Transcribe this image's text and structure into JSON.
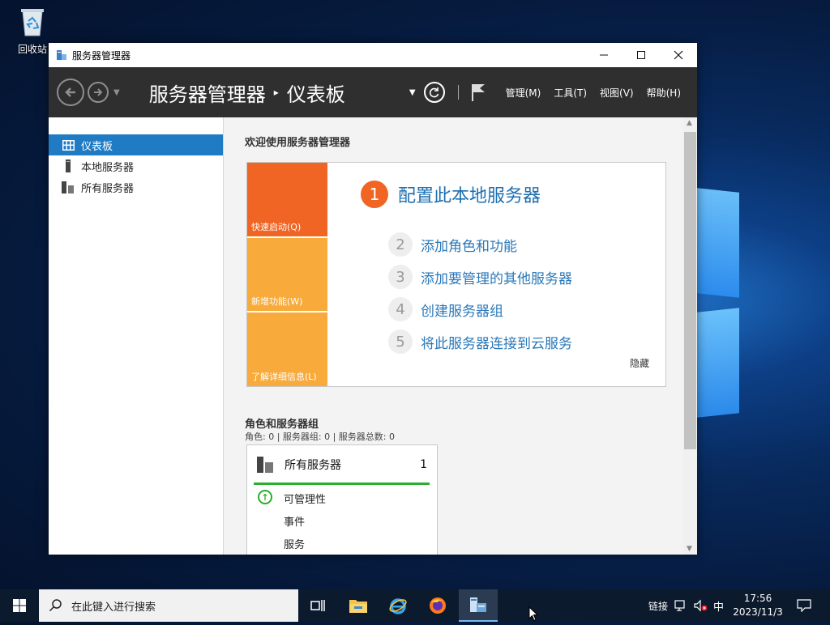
{
  "desktop": {
    "recycle_bin_label": "回收站"
  },
  "window": {
    "title": "服务器管理器",
    "controls": {
      "minimize": "—",
      "maximize": "☐",
      "close": "✕"
    }
  },
  "header": {
    "breadcrumb_root": "服务器管理器",
    "breadcrumb_sep": "▸",
    "breadcrumb_current": "仪表板",
    "menus": [
      "管理(M)",
      "工具(T)",
      "视图(V)",
      "帮助(H)"
    ]
  },
  "sidebar": {
    "items": [
      {
        "label": "仪表板",
        "icon": "dashboard-icon",
        "active": true
      },
      {
        "label": "本地服务器",
        "icon": "local-server-icon",
        "active": false
      },
      {
        "label": "所有服务器",
        "icon": "all-servers-icon",
        "active": false
      }
    ]
  },
  "main": {
    "welcome_title": "欢迎使用服务器管理器",
    "tiles": [
      "快速启动(Q)",
      "新增功能(W)",
      "了解详细信息(L)"
    ],
    "step1": {
      "num": "1",
      "label": "配置此本地服务器"
    },
    "steps": [
      {
        "num": "2",
        "label": "添加角色和功能"
      },
      {
        "num": "3",
        "label": "添加要管理的其他服务器"
      },
      {
        "num": "4",
        "label": "创建服务器组"
      },
      {
        "num": "5",
        "label": "将此服务器连接到云服务"
      }
    ],
    "hide_label": "隐藏",
    "roles_title": "角色和服务器组",
    "roles_subtitle": "角色: 0 | 服务器组: 0 | 服务器总数: 0",
    "card": {
      "name": "所有服务器",
      "count": "1",
      "rows": [
        "可管理性",
        "事件",
        "服务"
      ],
      "status_color": "#2bae2b"
    }
  },
  "taskbar": {
    "search_placeholder": "在此键入进行搜索",
    "tray_link": "链接",
    "ime": "中",
    "time": "17:56",
    "date": "2023/11/3"
  },
  "colors": {
    "accent_blue": "#1e7bc4",
    "quickstart_orange": "#f06523",
    "tile_amber": "#f8ab3b",
    "header_dark": "#2f2f2f"
  }
}
